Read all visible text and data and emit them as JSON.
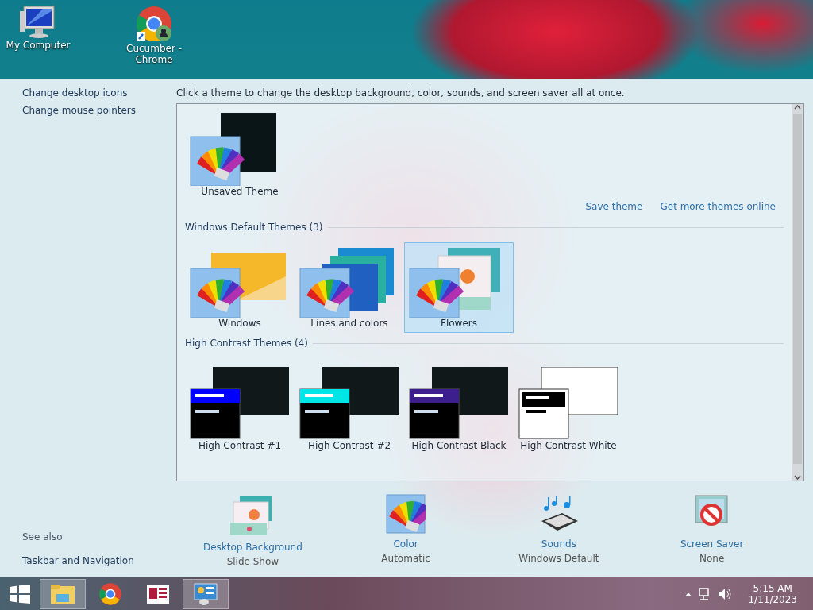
{
  "desktop_icons": [
    {
      "label": "My Computer",
      "kind": "computer"
    },
    {
      "label": "Cucumber - Chrome",
      "kind": "chrome"
    }
  ],
  "sidebar": {
    "links": [
      "Change desktop icons",
      "Change mouse pointers"
    ],
    "see_also": {
      "title": "See also",
      "links": [
        "Taskbar and Navigation"
      ]
    }
  },
  "instructions": "Click a theme to change the desktop background, color, sounds, and screen saver all at once.",
  "my_themes": [
    {
      "label": "Unsaved Theme",
      "kind": "dark",
      "selected": false
    }
  ],
  "theme_links": [
    "Save theme",
    "Get more themes online"
  ],
  "groups": [
    {
      "title": "Windows Default Themes (3)",
      "themes": [
        {
          "label": "Windows",
          "kind": "windows",
          "selected": false
        },
        {
          "label": "Lines and colors",
          "kind": "lines",
          "selected": false
        },
        {
          "label": "Flowers",
          "kind": "flowers",
          "selected": true
        }
      ]
    },
    {
      "title": "High Contrast Themes (4)",
      "themes": [
        {
          "label": "High Contrast #1",
          "kind": "contrast",
          "color": "#0000ff",
          "selected": false
        },
        {
          "label": "High Contrast #2",
          "kind": "contrast",
          "color": "#00e5e5",
          "selected": false
        },
        {
          "label": "High Contrast Black",
          "kind": "contrast",
          "color": "#3c1f8c",
          "selected": false
        },
        {
          "label": "High Contrast White",
          "kind": "contrast-white",
          "color": "#000000",
          "selected": false
        }
      ]
    }
  ],
  "settings": [
    {
      "label": "Desktop Background",
      "value": "Slide Show",
      "kind": "background"
    },
    {
      "label": "Color",
      "value": "Automatic",
      "kind": "color"
    },
    {
      "label": "Sounds",
      "value": "Windows Default",
      "kind": "sounds"
    },
    {
      "label": "Screen Saver",
      "value": "None",
      "kind": "screensaver"
    }
  ],
  "taskbar": {
    "apps": [
      {
        "kind": "explorer",
        "selected": true
      },
      {
        "kind": "chrome",
        "selected": false
      },
      {
        "kind": "reader",
        "selected": false
      },
      {
        "kind": "control-panel",
        "selected": true
      }
    ],
    "time": "5:15 AM",
    "date": "1/11/2023"
  }
}
